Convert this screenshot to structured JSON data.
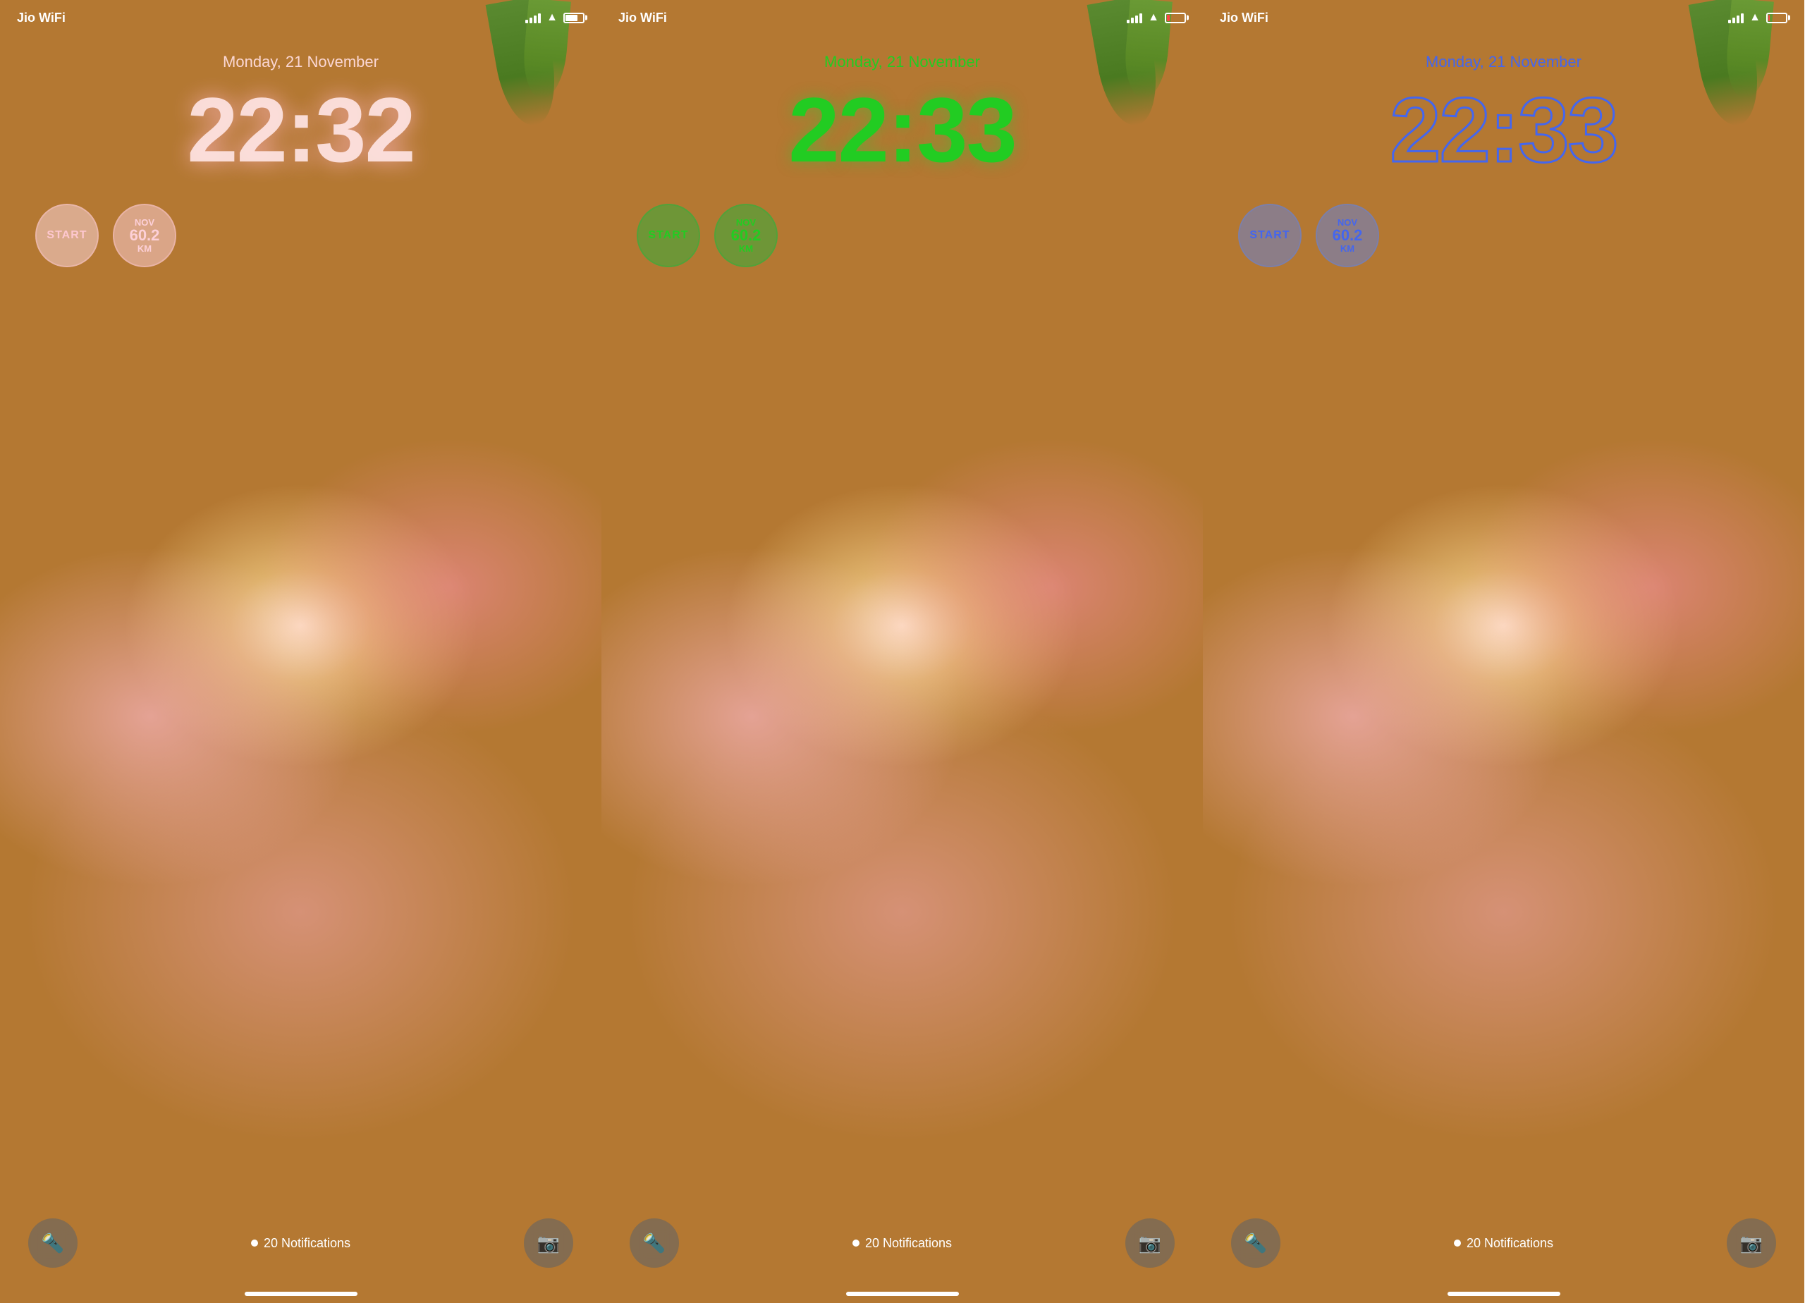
{
  "screens": [
    {
      "id": "screen1",
      "carrier": "Jio WiFi",
      "battery_level": "80",
      "date": "Monday, 21 November",
      "time": "22:32",
      "time_color": "pink_white",
      "date_color": "rgba(255, 220, 220, 0.95)",
      "widget_start": "START",
      "widget_nov": "NOV",
      "widget_km": "60.2",
      "widget_km_unit": "KM",
      "notifications": "20 Notifications",
      "torch_icon": "🔦",
      "camera_icon": "📷"
    },
    {
      "id": "screen2",
      "carrier": "Jio WiFi",
      "battery_level": "20",
      "date": "Monday, 21 November",
      "time": "22:33",
      "time_color": "green",
      "date_color": "#22cc22",
      "widget_start": "START",
      "widget_nov": "NOV",
      "widget_km": "60.2",
      "widget_km_unit": "KM",
      "notifications": "20 Notifications",
      "torch_icon": "🔦",
      "camera_icon": "📷"
    },
    {
      "id": "screen3",
      "carrier": "Jio WiFi",
      "battery_level": "10",
      "date": "Monday, 21 November",
      "time": "22:33",
      "time_color": "blue_outline",
      "date_color": "#4466ee",
      "widget_start": "START",
      "widget_nov": "NOV",
      "widget_km": "60.2",
      "widget_km_unit": "KM",
      "notifications": "20 Notifications",
      "torch_icon": "🔦",
      "camera_icon": "📷"
    }
  ]
}
